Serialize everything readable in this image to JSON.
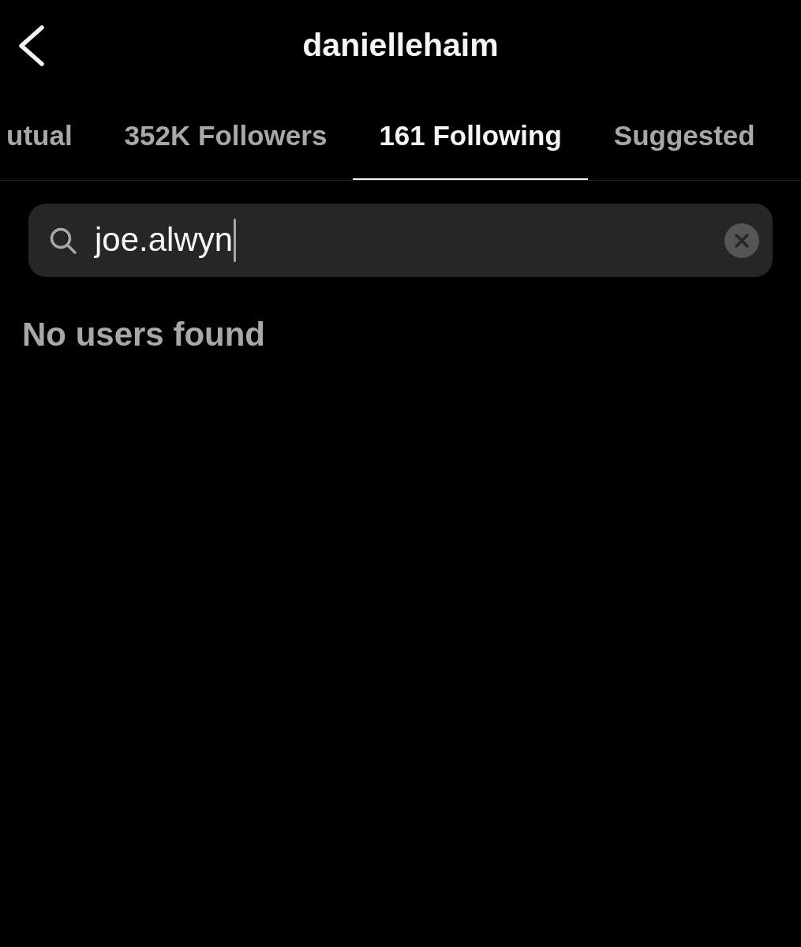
{
  "header": {
    "title": "daniellehaim"
  },
  "tabs": [
    {
      "label": "utual",
      "selected": false
    },
    {
      "label": "352K Followers",
      "selected": false
    },
    {
      "label": "161 Following",
      "selected": true
    },
    {
      "label": "Suggested",
      "selected": false
    }
  ],
  "search": {
    "value": "joe.alwyn",
    "focused": true
  },
  "results": {
    "empty_message": "No users found"
  }
}
